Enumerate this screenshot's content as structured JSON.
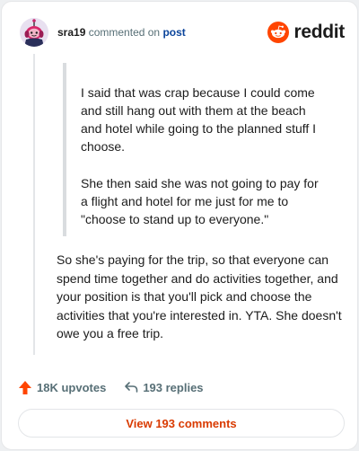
{
  "header": {
    "username": "sra19",
    "commented_text": "commented on",
    "post_link": "post",
    "logo_text": "reddit",
    "brand_color": "#ff4500"
  },
  "quote": {
    "paragraphs": [
      "I said that was crap because I could come and still hang out with them at the beach and hotel while going to the planned stuff I choose.",
      "She then said she was not going to pay for a flight and hotel for me just for me to \"choose to stand up to everyone.\""
    ]
  },
  "comment": {
    "body": "So she's paying for the trip, so that everyone can spend time together and do activities together, and your position is that you'll pick and choose the activities that you're interested in. YTA. She doesn't owe you a free trip."
  },
  "stats": {
    "upvotes": "18K upvotes",
    "replies": "193 replies",
    "upvote_icon": "upvote-arrow-icon",
    "reply_icon": "reply-arrow-icon"
  },
  "footer": {
    "view_comments_label": "View 193 comments"
  }
}
